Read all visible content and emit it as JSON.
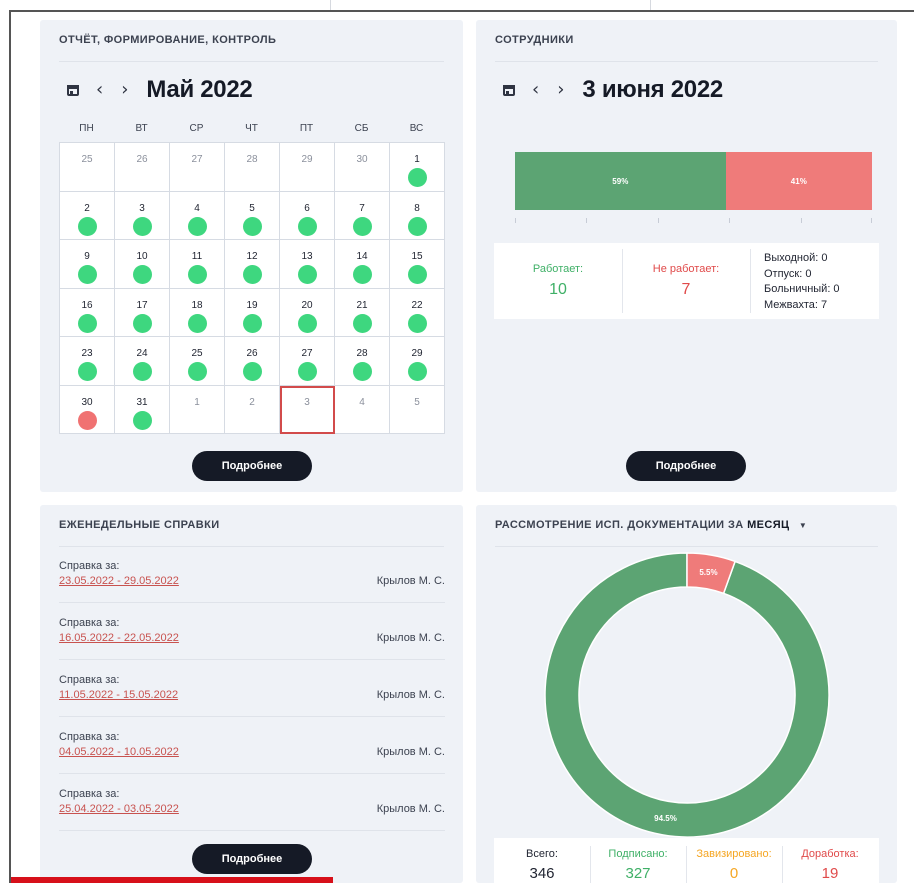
{
  "colors": {
    "work": "#5ca473",
    "notwork": "#ef7b7a",
    "green_dot": "#3ed77f",
    "red_dot": "#f07272",
    "dark": "#151a26",
    "pending": "#f5a623"
  },
  "calendar_panel": {
    "title": "ОТЧЁТ, ФОРМИРОВАНИЕ, КОНТРОЛЬ",
    "prev": "‹",
    "next": "›",
    "month_title": "Май 2022",
    "weekdays": [
      "ПН",
      "ВТ",
      "СР",
      "ЧТ",
      "ПТ",
      "СБ",
      "ВС"
    ],
    "weeks": [
      [
        {
          "d": "25",
          "out": true
        },
        {
          "d": "26",
          "out": true
        },
        {
          "d": "27",
          "out": true
        },
        {
          "d": "28",
          "out": true
        },
        {
          "d": "29",
          "out": true
        },
        {
          "d": "30",
          "out": true
        },
        {
          "d": "1",
          "s": "ok"
        }
      ],
      [
        {
          "d": "2",
          "s": "ok"
        },
        {
          "d": "3",
          "s": "ok"
        },
        {
          "d": "4",
          "s": "ok"
        },
        {
          "d": "5",
          "s": "ok"
        },
        {
          "d": "6",
          "s": "ok"
        },
        {
          "d": "7",
          "s": "ok"
        },
        {
          "d": "8",
          "s": "ok"
        }
      ],
      [
        {
          "d": "9",
          "s": "ok"
        },
        {
          "d": "10",
          "s": "ok"
        },
        {
          "d": "11",
          "s": "ok"
        },
        {
          "d": "12",
          "s": "ok"
        },
        {
          "d": "13",
          "s": "ok"
        },
        {
          "d": "14",
          "s": "ok"
        },
        {
          "d": "15",
          "s": "ok"
        }
      ],
      [
        {
          "d": "16",
          "s": "ok"
        },
        {
          "d": "17",
          "s": "ok"
        },
        {
          "d": "18",
          "s": "ok"
        },
        {
          "d": "19",
          "s": "ok"
        },
        {
          "d": "20",
          "s": "ok"
        },
        {
          "d": "21",
          "s": "ok"
        },
        {
          "d": "22",
          "s": "ok"
        }
      ],
      [
        {
          "d": "23",
          "s": "ok"
        },
        {
          "d": "24",
          "s": "ok"
        },
        {
          "d": "25",
          "s": "ok"
        },
        {
          "d": "26",
          "s": "ok"
        },
        {
          "d": "27",
          "s": "ok"
        },
        {
          "d": "28",
          "s": "ok"
        },
        {
          "d": "29",
          "s": "ok"
        }
      ],
      [
        {
          "d": "30",
          "s": "bad"
        },
        {
          "d": "31",
          "s": "ok"
        },
        {
          "d": "1",
          "out": true
        },
        {
          "d": "2",
          "out": true
        },
        {
          "d": "3",
          "out": true,
          "selected": true
        },
        {
          "d": "4",
          "out": true
        },
        {
          "d": "5",
          "out": true
        }
      ]
    ],
    "button": "Подробнее"
  },
  "staff_panel": {
    "title": "СОТРУДНИКИ",
    "prev": "‹",
    "next": "›",
    "date_title": "3 июня 2022",
    "working_pct": 59,
    "not_working_pct": 41,
    "working_pct_label": "59%",
    "not_working_pct_label": "41%",
    "working_label": "Работает:",
    "working_value": "10",
    "not_working_label": "Не работает:",
    "not_working_value": "7",
    "breakdown": [
      "Выходной: 0",
      "Отпуск: 0",
      "Больничный: 0",
      "Межвахта: 7"
    ],
    "button": "Подробнее"
  },
  "weekly_panel": {
    "title": "ЕЖЕНЕДЕЛЬНЫЕ СПРАВКИ",
    "reports": [
      {
        "label": "Справка за:",
        "period": "23.05.2022 - 29.05.2022",
        "author": "Крылов М. С."
      },
      {
        "label": "Справка за:",
        "period": "16.05.2022 - 22.05.2022",
        "author": "Крылов М. С."
      },
      {
        "label": "Справка за:",
        "period": "11.05.2022 - 15.05.2022",
        "author": "Крылов М. С."
      },
      {
        "label": "Справка за:",
        "period": "04.05.2022 - 10.05.2022",
        "author": "Крылов М. С."
      },
      {
        "label": "Справка за:",
        "period": "25.04.2022 - 03.05.2022",
        "author": "Крылов М. С."
      }
    ],
    "button": "Подробнее"
  },
  "docs_panel": {
    "title_prefix": "РАССМОТРЕНИЕ ИСП. ДОКУМЕНТАЦИИ ЗА",
    "period": "МЕСЯЦ",
    "dropdown_icon": "▼",
    "chart_data": {
      "type": "pie",
      "categories": [
        "Подписано",
        "Доработка"
      ],
      "values": [
        94.5,
        5.5
      ],
      "labels": [
        "94.5%",
        "5.5%"
      ]
    },
    "stats": [
      {
        "label": "Всего:",
        "value": "346",
        "color": "#1f2330"
      },
      {
        "label": "Подписано:",
        "value": "327",
        "color": "#3fb067"
      },
      {
        "label": "Завизировано:",
        "value": "0",
        "color": "#f5a623"
      },
      {
        "label": "Доработка:",
        "value": "19",
        "color": "#e04a4a"
      }
    ]
  }
}
